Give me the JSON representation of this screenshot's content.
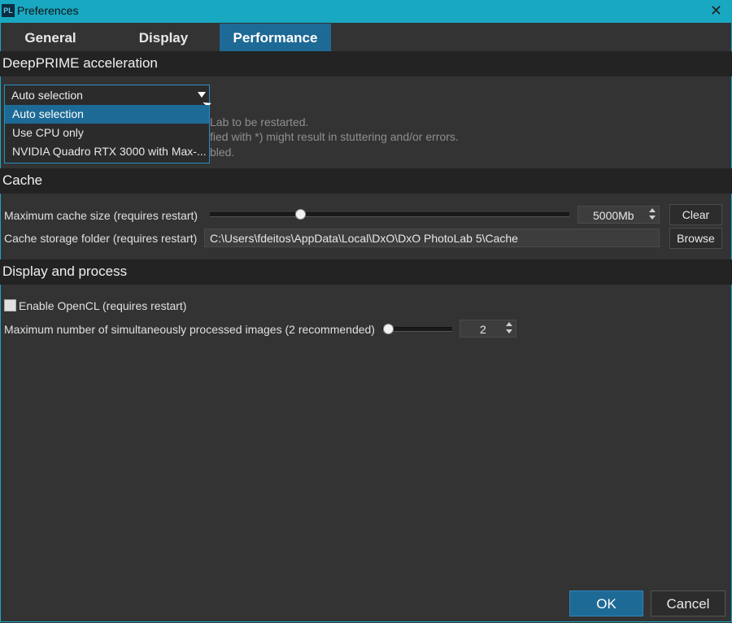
{
  "window": {
    "title": "Preferences",
    "icon_text": "PL",
    "close_icon": "close-icon"
  },
  "tabs": [
    {
      "label": "General"
    },
    {
      "label": "Display"
    },
    {
      "label": "Performance",
      "active": true
    }
  ],
  "deepprime": {
    "header": "DeepPRIME acceleration",
    "selected": "Auto selection",
    "options": [
      "Auto selection",
      "Use CPU only",
      "NVIDIA Quadro RTX 3000 with Max-..."
    ],
    "info_lines": [
      "Lab to be restarted.",
      "fied with *) might result in stuttering and/or errors.",
      "bled."
    ]
  },
  "cache": {
    "header": "Cache",
    "size_label": "Maximum cache size (requires restart)",
    "size_value": "5000Mb",
    "size_slider_fraction": 0.25,
    "clear_label": "Clear",
    "folder_label": "Cache storage folder (requires restart)",
    "folder_path": "C:\\Users\\fdeitos\\AppData\\Local\\DxO\\DxO PhotoLab 5\\Cache",
    "browse_label": "Browse"
  },
  "display_process": {
    "header": "Display and process",
    "opencl_label": "Enable OpenCL (requires restart)",
    "opencl_checked": false,
    "max_images_label": "Maximum number of simultaneously processed images (2 recommended)",
    "max_images_value": "2",
    "max_images_slider_fraction": 0.0
  },
  "footer": {
    "ok_label": "OK",
    "cancel_label": "Cancel"
  },
  "colors": {
    "accent": "#1e6a96",
    "titlebar": "#18a8c2",
    "background": "#333333",
    "section_header": "#232323"
  }
}
